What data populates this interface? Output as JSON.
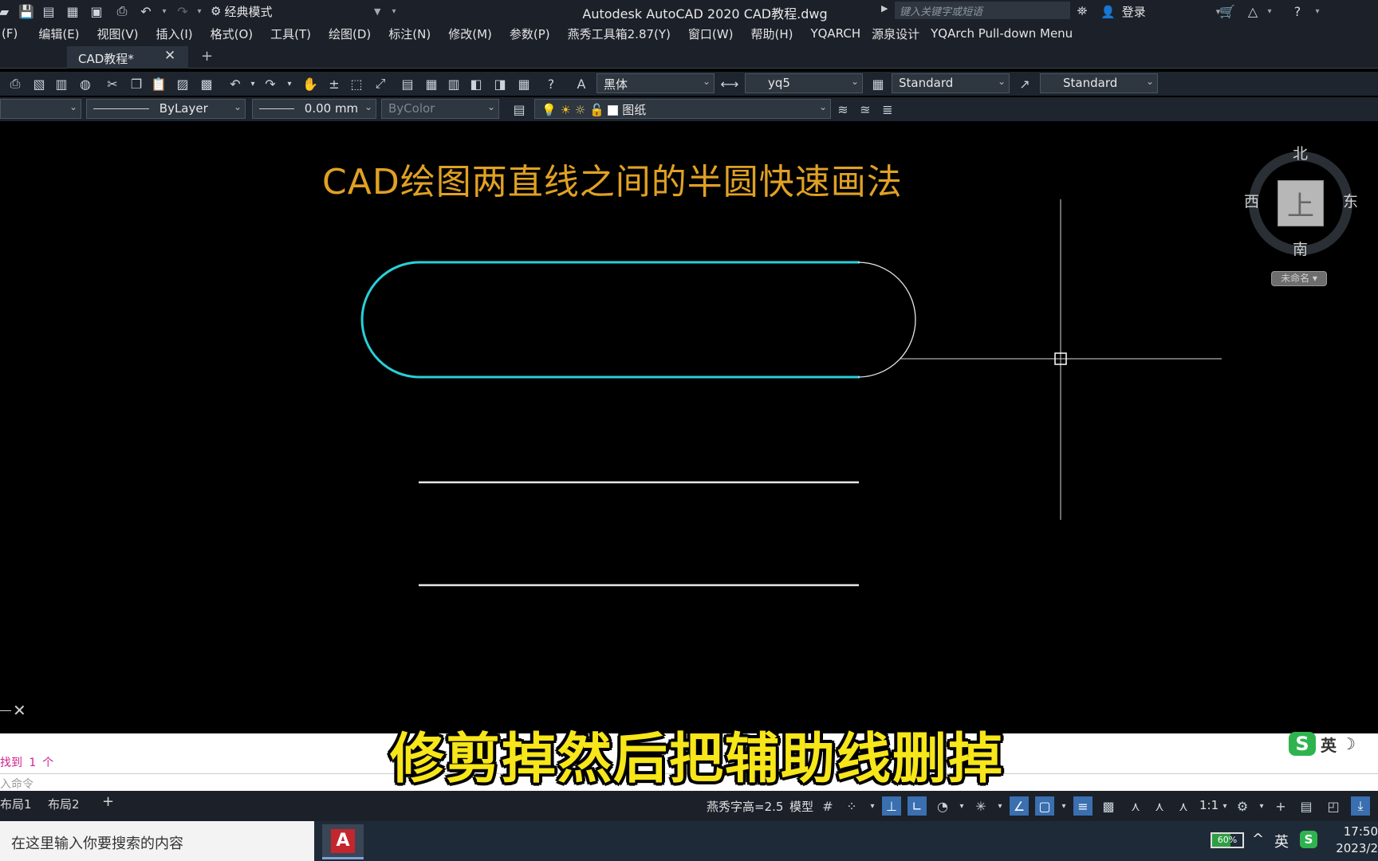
{
  "titlebar": {
    "workspace": "经典模式",
    "app_title": "Autodesk AutoCAD 2020    CAD教程.dwg",
    "search_placeholder": "键入关键字或短语",
    "login_label": "登录"
  },
  "menubar": {
    "items": [
      "(F)",
      "编辑(E)",
      "视图(V)",
      "插入(I)",
      "格式(O)",
      "工具(T)",
      "绘图(D)",
      "标注(N)",
      "修改(M)",
      "参数(P)",
      "燕秀工具箱2.87(Y)",
      "窗口(W)",
      "帮助(H)",
      "YQARCH",
      "源泉设计",
      "YQArch Pull-down Menu"
    ]
  },
  "tabs": {
    "active": "CAD教程*"
  },
  "toolbar1": {
    "text_style": "黑体",
    "dim_style": "yq5",
    "table_style": "Standard",
    "multileader_style": "Standard"
  },
  "toolbar2": {
    "linetype": "ByLayer",
    "lineweight": "0.00 mm",
    "color": "ByColor",
    "layer": "图纸"
  },
  "canvas": {
    "title": "CAD绘图两直线之间的半圆快速画法",
    "viewcube": {
      "top": "上",
      "north": "北",
      "south": "南",
      "east": "东",
      "west": "西"
    },
    "ucs_label": "未命名"
  },
  "command": {
    "history": "找到 1 个",
    "prompt": "入命令"
  },
  "subtitle": "修剪掉然后把辅助线删掉",
  "ime": {
    "lang": "英"
  },
  "statusbar": {
    "layouts": [
      "布局1",
      "布局2"
    ],
    "text_height": "燕秀字高=2.5",
    "model": "模型",
    "scale": "1:1"
  },
  "taskbar": {
    "search_placeholder": "在这里输入你要搜索的内容",
    "battery": "60%",
    "battery_level": 0.6,
    "lang": "英",
    "time": "17:50",
    "date": "2023/2"
  },
  "colors": {
    "polyline_highlight": "#29d0d8",
    "title_orange": "#e0a123",
    "subtitle_yellow": "#f6e61a"
  }
}
